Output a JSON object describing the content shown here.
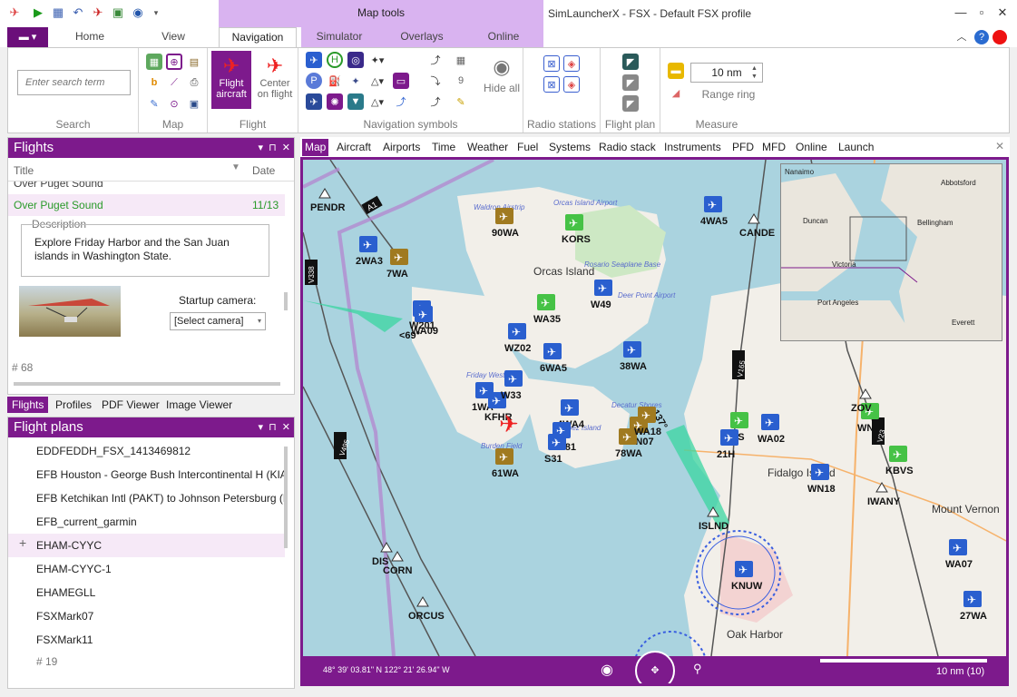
{
  "window": {
    "title": "SimLauncherX - FSX - Default FSX profile",
    "context_group": "Map tools"
  },
  "ribbon": {
    "file_label": "▬ ▾",
    "tabs": [
      "Home",
      "View",
      "Navigation",
      "Simulator",
      "Overlays",
      "Online"
    ],
    "active_tab": "Navigation",
    "search": {
      "placeholder": "Enter search term",
      "group_label": "Search"
    },
    "map_group_label": "Map",
    "flight_group": {
      "label": "Flight",
      "flight_aircraft": "Flight aircraft",
      "center_on_flight": "Center on flight"
    },
    "nav_symbols_label": "Navigation symbols",
    "hide_all": "Hide all",
    "radio_stations_label": "Radio stations",
    "flight_plan_label": "Flight plan",
    "measure": {
      "label": "Measure",
      "range_value": "10 nm",
      "range_ring": "Range ring"
    }
  },
  "flights_panel": {
    "title": "Flights",
    "columns": {
      "title": "Title",
      "date": "Date"
    },
    "partial_top": "Over Puget Sound",
    "selected": {
      "title": "Over Puget Sound",
      "date": "11/13"
    },
    "description_label": "Description",
    "description": "Explore Friday Harbor and the San Juan islands in Washington State.",
    "startup_camera_label": "Startup camera:",
    "camera_value": "[Select camera]",
    "count": "# 68",
    "bottom_tabs": [
      "Flights",
      "Profiles",
      "PDF Viewer",
      "Image Viewer"
    ]
  },
  "plans_panel": {
    "title": "Flight plans",
    "items": [
      "EDDFEDDH_FSX_1413469812",
      "EFB Houston - George Bush Intercontinental H (KIA",
      "EFB Ketchikan Intl (PAKT) to Johnson Petersburg (P",
      "EFB_current_garmin",
      "EHAM-CYYC",
      "EHAM-CYYC-1",
      "EHAMEGLL",
      "FSXMark07",
      "FSXMark11"
    ],
    "selected_index": 4,
    "count": "# 19"
  },
  "map": {
    "tabs": [
      "Map",
      "Aircraft",
      "Airports",
      "Time",
      "Weather",
      "Fuel",
      "Systems",
      "Radio stack",
      "Instruments",
      "PFD",
      "MFD",
      "Online",
      "Launch"
    ],
    "active_tab": "Map",
    "coordinates": "48° 39' 03.81\" N 122° 21' 26.94\" W",
    "scale": "10 nm (10)",
    "airports": [
      "90WA",
      "KORS",
      "4WA5",
      "2WA3",
      "7WA",
      "W49",
      "W201",
      "WA09",
      "WA35",
      "WZ02",
      "6WA5",
      "38WA",
      "1WA",
      "KFHR",
      "W33",
      "4WA4",
      "WA81",
      "WN07",
      "78WA",
      "WA18",
      "S31",
      "61WA",
      "74S",
      "WA02",
      "21H",
      "WN18",
      "WN",
      "KBVS",
      "WA07",
      "27WA",
      "KNUW"
    ],
    "navaids": [
      "PENDR",
      "CANDE",
      "ZOV",
      "ISLND",
      "IWANY",
      "DIS",
      "ORCUS",
      "CORN"
    ],
    "airways": [
      "A1",
      "V338",
      "V495",
      "V165",
      "V23"
    ],
    "places": [
      "Orcas Island",
      "Fidalgo Island",
      "Mount Vernon",
      "Oak Harbor",
      "Orcas Island Airport",
      "Friday West",
      "Lopez Island",
      "Rosario Seaplane Base",
      "Deer Point Airport",
      "Decatur Shores",
      "Burden Field",
      "Waldron Airstrip"
    ],
    "heading": "137°",
    "heading2": "<69°",
    "minimap_places": [
      "Nanaimo",
      "Abbotsford",
      "Duncan",
      "Bellingham",
      "Victoria",
      "Port Angeles",
      "Everett"
    ]
  }
}
